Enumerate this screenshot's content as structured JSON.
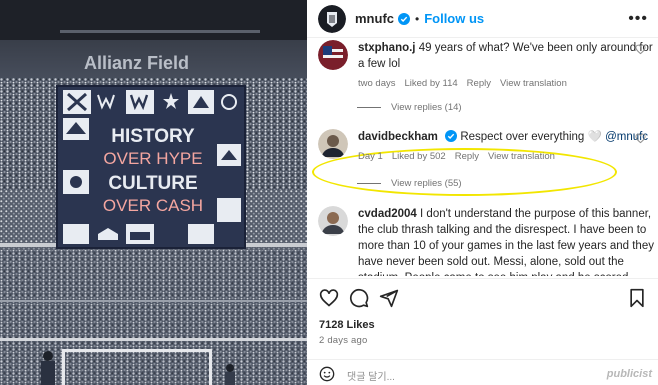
{
  "post": {
    "account": "mnufc",
    "follow_label": "Follow us",
    "dot": "•",
    "more": "•••"
  },
  "photo": {
    "stadium_sign": "Allianz Field",
    "banner_lines": [
      "HISTORY",
      "OVER HYPE",
      "CULTURE",
      "OVER CASH"
    ],
    "banner_colors": {
      "navy": "#2b3550",
      "light": "#e8ecf2",
      "accent": "#f4a6a0"
    }
  },
  "comments": [
    {
      "username": "stxphano.j",
      "text": "49 years of what? We've been only around for a few lol",
      "time": "two days",
      "likes": "Liked by 114",
      "reply": "Reply",
      "translate": "View translation",
      "view_replies": "View replies (14)"
    },
    {
      "username": "davidbeckham",
      "text": "Respect over everything",
      "emoji": "🤍",
      "mention": "@mnufc",
      "time": "Day 1",
      "likes": "Liked by 502",
      "reply": "Reply",
      "translate": "View translation",
      "view_replies": "View replies (55)"
    },
    {
      "username": "cvdad2004",
      "text": "I don't understand the purpose of this banner, the club thrash talking and the disrespect. I have been to more than 10 of your games in the last few years and they have never been sold out. Messi, alone, sold out the stadium. People came to see him play and he scored. Take the win and stay"
    }
  ],
  "actions": {
    "likes_count": "7128 Likes",
    "posted_ago": "2 days ago",
    "comment_placeholder": "댓글 달기...",
    "icons": [
      "heart-icon",
      "comment-icon",
      "share-icon",
      "bookmark-icon",
      "emoji-icon"
    ]
  },
  "watermark": "publicist",
  "colors": {
    "follow_blue": "#0095f6",
    "verified_blue": "#0095f6",
    "highlight": "#f2e600",
    "meta_gray": "#737373"
  }
}
